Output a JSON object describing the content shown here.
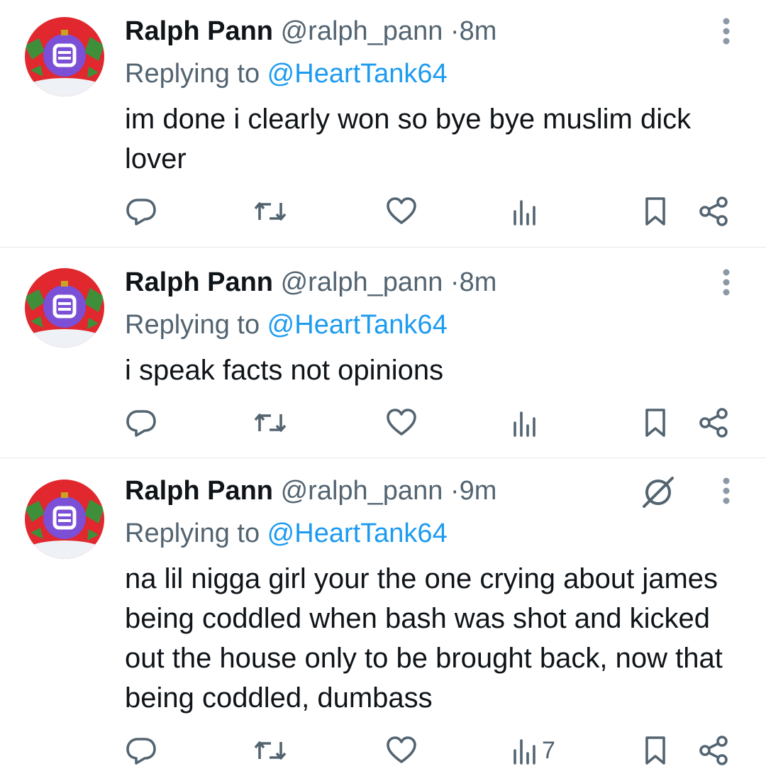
{
  "tweets": [
    {
      "name": "Ralph Pann",
      "handle": "@ralph_pann",
      "separator": "·",
      "time": "8m",
      "replying_prefix": "Replying to ",
      "replying_to": "@HeartTank64",
      "text": "im done i clearly won so bye bye muslim dick lover",
      "views": "",
      "show_grok": false
    },
    {
      "name": "Ralph Pann",
      "handle": "@ralph_pann",
      "separator": "·",
      "time": "8m",
      "replying_prefix": "Replying to ",
      "replying_to": "@HeartTank64",
      "text": "i speak facts not opinions",
      "views": "",
      "show_grok": false
    },
    {
      "name": "Ralph Pann",
      "handle": "@ralph_pann",
      "separator": "·",
      "time": "9m",
      "replying_prefix": "Replying to ",
      "replying_to": "@HeartTank64",
      "text": "na lil nigga girl your the one crying about james being coddled when bash was shot and kicked out the house only to be brought back, now that being coddled, dumbass",
      "views": "7",
      "show_grok": true
    }
  ],
  "icons": {
    "reply": "reply-icon",
    "retweet": "retweet-icon",
    "like": "like-icon",
    "views": "views-icon",
    "bookmark": "bookmark-icon",
    "share": "share-icon",
    "more": "more-vertical-icon",
    "grok": "grok-icon"
  },
  "colors": {
    "text": "#0f1419",
    "muted": "#536471",
    "mention": "#1d9bf0",
    "divider": "#e6e8ea",
    "avatar_red": "#e0282e",
    "avatar_green": "#3f8f3a",
    "avatar_purple": "#7b4fd6"
  }
}
